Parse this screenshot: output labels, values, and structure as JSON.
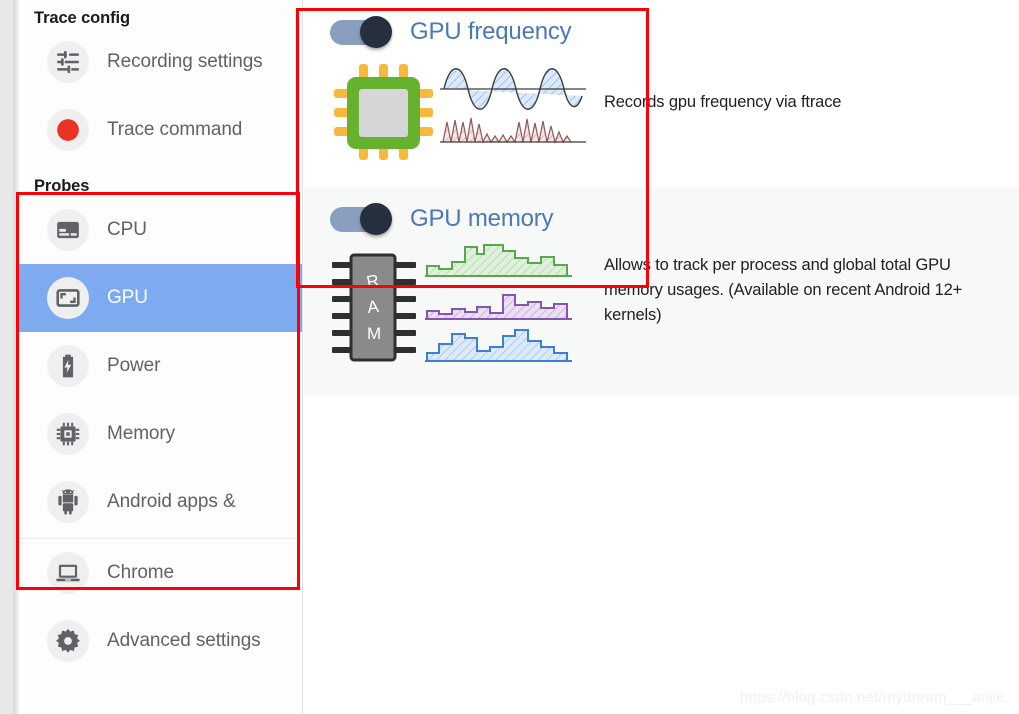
{
  "sidebar": {
    "sections": [
      {
        "title": "Trace config",
        "items": [
          {
            "label": "Recording settings",
            "icon": "tune-icon",
            "selected": false
          },
          {
            "label": "Trace command",
            "icon": "record-circle-icon",
            "selected": false
          }
        ]
      },
      {
        "title": "Probes",
        "items": [
          {
            "label": "CPU",
            "icon": "cpu-icon",
            "selected": false
          },
          {
            "label": "GPU",
            "icon": "gpu-icon",
            "selected": true
          },
          {
            "label": "Power",
            "icon": "battery-icon",
            "selected": false
          },
          {
            "label": "Memory",
            "icon": "memory-chip-icon",
            "selected": false
          },
          {
            "label": "Android apps &",
            "icon": "android-icon",
            "selected": false
          }
        ]
      },
      {
        "title": "",
        "items": [
          {
            "label": "Chrome",
            "icon": "laptop-icon",
            "selected": false
          },
          {
            "label": "Advanced settings",
            "icon": "gear-icon",
            "selected": false
          }
        ]
      }
    ]
  },
  "main": {
    "cards": [
      {
        "title": "GPU frequency",
        "description": "Records gpu frequency via ftrace",
        "toggle_state": "on",
        "illustration": "cpu-chip-waveforms-illustration"
      },
      {
        "title": "GPU memory",
        "description": "Allows to track per process and global total GPU memory usages. (Available on recent Android 12+ kernels)",
        "toggle_state": "on",
        "illustration": "ram-chip-step-charts-illustration"
      }
    ]
  },
  "annotations": {
    "box_color": "#fb0007",
    "boxes": [
      {
        "name": "gpu-panels-highlight"
      },
      {
        "name": "probes-highlight"
      }
    ]
  },
  "watermark": {
    "text": "https://blog.csdn.net/mydream___anjie"
  },
  "colors": {
    "selected_row": "#7eaaf0",
    "card_title": "#4c79b4",
    "toggle_knob": "#252f3d",
    "toggle_track": "#8a9fc0",
    "annotation_red": "#fb0007"
  }
}
